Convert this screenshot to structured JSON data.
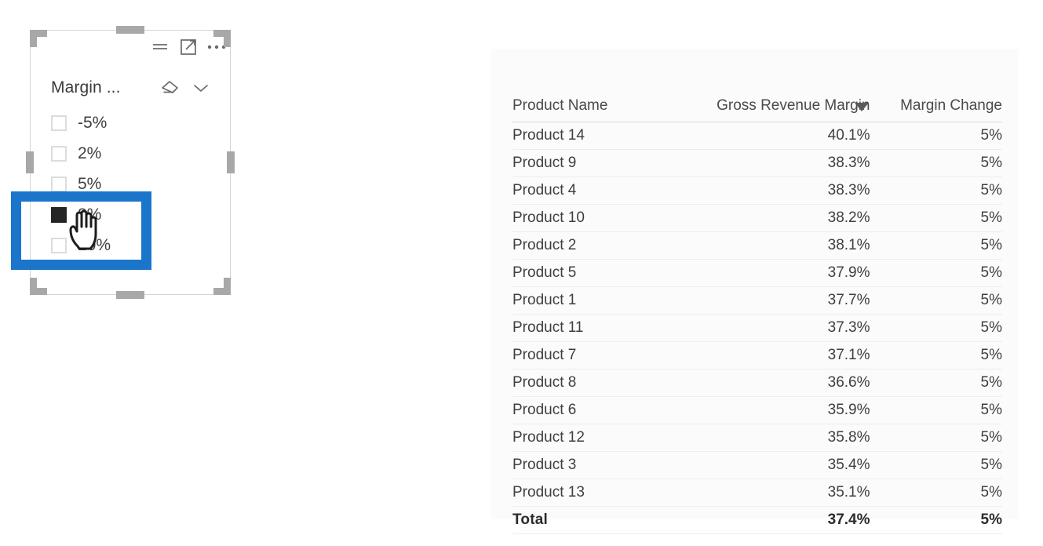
{
  "slicer": {
    "field_label": "Margin ...",
    "header_icons": [
      {
        "name": "filter-icon",
        "label": "Filters"
      },
      {
        "name": "focus-mode-icon",
        "label": "Focus mode"
      },
      {
        "name": "more-options-icon",
        "label": "More options"
      }
    ],
    "title_actions": [
      {
        "name": "clear-selections-icon",
        "label": "Clear selections"
      },
      {
        "name": "chevron-down-icon",
        "label": "Expand"
      }
    ],
    "items": [
      {
        "label": "-5%",
        "selected": false
      },
      {
        "label": "2%",
        "selected": false
      },
      {
        "label": "5%",
        "selected": false
      },
      {
        "label": "8%",
        "selected": true
      },
      {
        "label": "10%",
        "selected": false
      }
    ]
  },
  "annotation": {
    "color": "#1b75cb",
    "target": "8%"
  },
  "cursor": {
    "type": "pointing-hand"
  },
  "table": {
    "columns": [
      {
        "key": "name",
        "label": "Product Name",
        "align": "left",
        "sorted": false
      },
      {
        "key": "grm",
        "label": "Gross Revenue Margin",
        "align": "right",
        "sorted": true,
        "sort_direction": "descending"
      },
      {
        "key": "mc",
        "label": "Margin Change",
        "align": "right",
        "sorted": false
      }
    ],
    "rows": [
      {
        "name": "Product 14",
        "grm": "40.1%",
        "mc": "5%"
      },
      {
        "name": "Product 9",
        "grm": "38.3%",
        "mc": "5%"
      },
      {
        "name": "Product 4",
        "grm": "38.3%",
        "mc": "5%"
      },
      {
        "name": "Product 10",
        "grm": "38.2%",
        "mc": "5%"
      },
      {
        "name": "Product 2",
        "grm": "38.1%",
        "mc": "5%"
      },
      {
        "name": "Product 5",
        "grm": "37.9%",
        "mc": "5%"
      },
      {
        "name": "Product 1",
        "grm": "37.7%",
        "mc": "5%"
      },
      {
        "name": "Product 11",
        "grm": "37.3%",
        "mc": "5%"
      },
      {
        "name": "Product 7",
        "grm": "37.1%",
        "mc": "5%"
      },
      {
        "name": "Product 8",
        "grm": "36.6%",
        "mc": "5%"
      },
      {
        "name": "Product 6",
        "grm": "35.9%",
        "mc": "5%"
      },
      {
        "name": "Product 12",
        "grm": "35.8%",
        "mc": "5%"
      },
      {
        "name": "Product 3",
        "grm": "35.4%",
        "mc": "5%"
      },
      {
        "name": "Product 13",
        "grm": "35.1%",
        "mc": "5%"
      }
    ],
    "total": {
      "name": "Total",
      "grm": "37.4%",
      "mc": "5%"
    }
  },
  "chart_data": {
    "type": "table",
    "title": "",
    "columns": [
      "Product Name",
      "Gross Revenue Margin",
      "Margin Change"
    ],
    "sort": {
      "column": "Gross Revenue Margin",
      "direction": "descending"
    },
    "categories": [
      "Product 14",
      "Product 9",
      "Product 4",
      "Product 10",
      "Product 2",
      "Product 5",
      "Product 1",
      "Product 11",
      "Product 7",
      "Product 8",
      "Product 6",
      "Product 12",
      "Product 3",
      "Product 13"
    ],
    "series": [
      {
        "name": "Gross Revenue Margin",
        "values": [
          40.1,
          38.3,
          38.3,
          38.2,
          38.1,
          37.9,
          37.7,
          37.3,
          37.1,
          36.6,
          35.9,
          35.8,
          35.4,
          35.1
        ],
        "unit": "%"
      },
      {
        "name": "Margin Change",
        "values": [
          5,
          5,
          5,
          5,
          5,
          5,
          5,
          5,
          5,
          5,
          5,
          5,
          5,
          5
        ],
        "unit": "%"
      }
    ],
    "total": {
      "Gross Revenue Margin": 37.4,
      "Margin Change": 5
    }
  }
}
